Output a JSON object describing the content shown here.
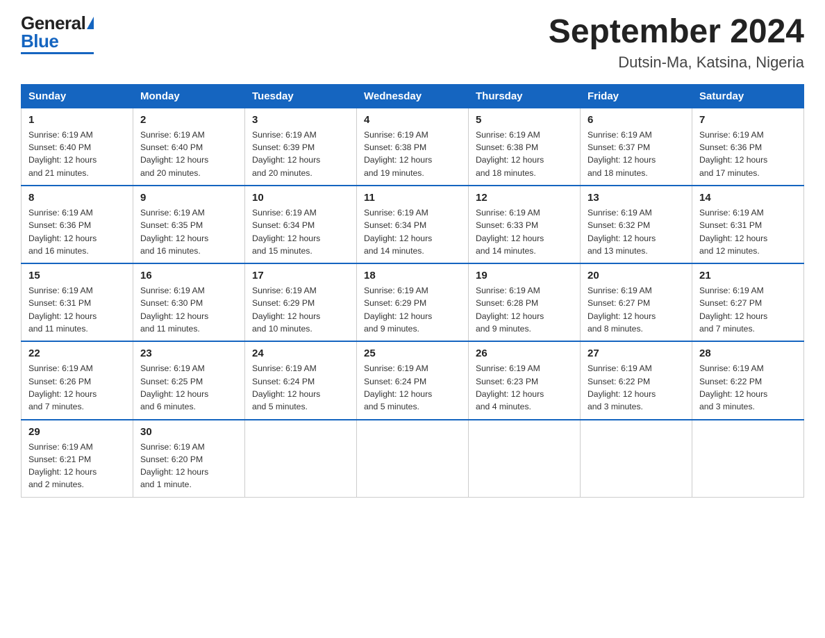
{
  "header": {
    "logo_general": "General",
    "logo_blue": "Blue",
    "month_title": "September 2024",
    "location": "Dutsin-Ma, Katsina, Nigeria"
  },
  "days_of_week": [
    "Sunday",
    "Monday",
    "Tuesday",
    "Wednesday",
    "Thursday",
    "Friday",
    "Saturday"
  ],
  "weeks": [
    [
      {
        "day": "1",
        "sunrise": "6:19 AM",
        "sunset": "6:40 PM",
        "daylight": "12 hours and 21 minutes."
      },
      {
        "day": "2",
        "sunrise": "6:19 AM",
        "sunset": "6:40 PM",
        "daylight": "12 hours and 20 minutes."
      },
      {
        "day": "3",
        "sunrise": "6:19 AM",
        "sunset": "6:39 PM",
        "daylight": "12 hours and 20 minutes."
      },
      {
        "day": "4",
        "sunrise": "6:19 AM",
        "sunset": "6:38 PM",
        "daylight": "12 hours and 19 minutes."
      },
      {
        "day": "5",
        "sunrise": "6:19 AM",
        "sunset": "6:38 PM",
        "daylight": "12 hours and 18 minutes."
      },
      {
        "day": "6",
        "sunrise": "6:19 AM",
        "sunset": "6:37 PM",
        "daylight": "12 hours and 18 minutes."
      },
      {
        "day": "7",
        "sunrise": "6:19 AM",
        "sunset": "6:36 PM",
        "daylight": "12 hours and 17 minutes."
      }
    ],
    [
      {
        "day": "8",
        "sunrise": "6:19 AM",
        "sunset": "6:36 PM",
        "daylight": "12 hours and 16 minutes."
      },
      {
        "day": "9",
        "sunrise": "6:19 AM",
        "sunset": "6:35 PM",
        "daylight": "12 hours and 16 minutes."
      },
      {
        "day": "10",
        "sunrise": "6:19 AM",
        "sunset": "6:34 PM",
        "daylight": "12 hours and 15 minutes."
      },
      {
        "day": "11",
        "sunrise": "6:19 AM",
        "sunset": "6:34 PM",
        "daylight": "12 hours and 14 minutes."
      },
      {
        "day": "12",
        "sunrise": "6:19 AM",
        "sunset": "6:33 PM",
        "daylight": "12 hours and 14 minutes."
      },
      {
        "day": "13",
        "sunrise": "6:19 AM",
        "sunset": "6:32 PM",
        "daylight": "12 hours and 13 minutes."
      },
      {
        "day": "14",
        "sunrise": "6:19 AM",
        "sunset": "6:31 PM",
        "daylight": "12 hours and 12 minutes."
      }
    ],
    [
      {
        "day": "15",
        "sunrise": "6:19 AM",
        "sunset": "6:31 PM",
        "daylight": "12 hours and 11 minutes."
      },
      {
        "day": "16",
        "sunrise": "6:19 AM",
        "sunset": "6:30 PM",
        "daylight": "12 hours and 11 minutes."
      },
      {
        "day": "17",
        "sunrise": "6:19 AM",
        "sunset": "6:29 PM",
        "daylight": "12 hours and 10 minutes."
      },
      {
        "day": "18",
        "sunrise": "6:19 AM",
        "sunset": "6:29 PM",
        "daylight": "12 hours and 9 minutes."
      },
      {
        "day": "19",
        "sunrise": "6:19 AM",
        "sunset": "6:28 PM",
        "daylight": "12 hours and 9 minutes."
      },
      {
        "day": "20",
        "sunrise": "6:19 AM",
        "sunset": "6:27 PM",
        "daylight": "12 hours and 8 minutes."
      },
      {
        "day": "21",
        "sunrise": "6:19 AM",
        "sunset": "6:27 PM",
        "daylight": "12 hours and 7 minutes."
      }
    ],
    [
      {
        "day": "22",
        "sunrise": "6:19 AM",
        "sunset": "6:26 PM",
        "daylight": "12 hours and 7 minutes."
      },
      {
        "day": "23",
        "sunrise": "6:19 AM",
        "sunset": "6:25 PM",
        "daylight": "12 hours and 6 minutes."
      },
      {
        "day": "24",
        "sunrise": "6:19 AM",
        "sunset": "6:24 PM",
        "daylight": "12 hours and 5 minutes."
      },
      {
        "day": "25",
        "sunrise": "6:19 AM",
        "sunset": "6:24 PM",
        "daylight": "12 hours and 5 minutes."
      },
      {
        "day": "26",
        "sunrise": "6:19 AM",
        "sunset": "6:23 PM",
        "daylight": "12 hours and 4 minutes."
      },
      {
        "day": "27",
        "sunrise": "6:19 AM",
        "sunset": "6:22 PM",
        "daylight": "12 hours and 3 minutes."
      },
      {
        "day": "28",
        "sunrise": "6:19 AM",
        "sunset": "6:22 PM",
        "daylight": "12 hours and 3 minutes."
      }
    ],
    [
      {
        "day": "29",
        "sunrise": "6:19 AM",
        "sunset": "6:21 PM",
        "daylight": "12 hours and 2 minutes."
      },
      {
        "day": "30",
        "sunrise": "6:19 AM",
        "sunset": "6:20 PM",
        "daylight": "12 hours and 1 minute."
      },
      null,
      null,
      null,
      null,
      null
    ]
  ]
}
